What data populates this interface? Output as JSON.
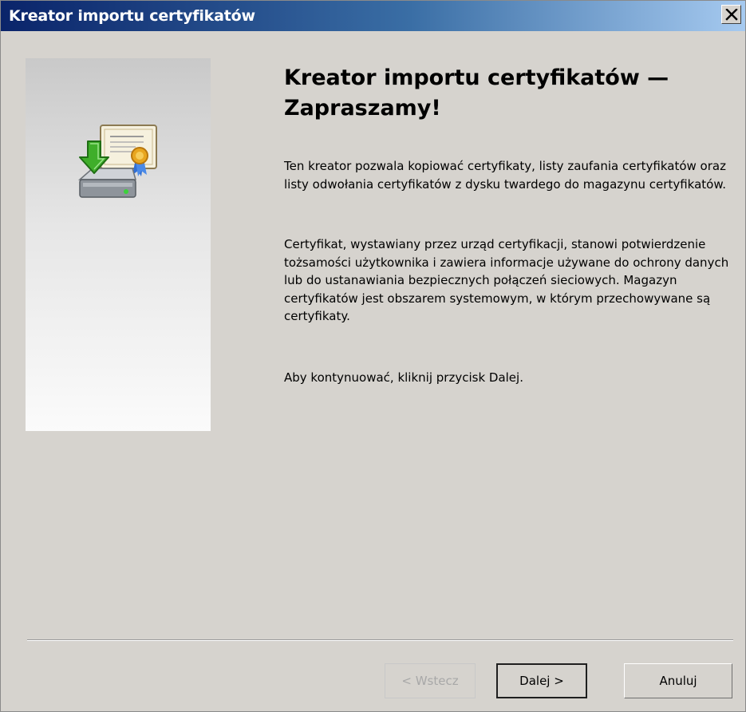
{
  "window": {
    "title": "Kreator importu certyfikatów"
  },
  "content": {
    "heading": "Kreator importu certyfikatów — Zapraszamy!",
    "paragraph1": "Ten kreator pozwala kopiować certyfikaty, listy zaufania certyfikatów oraz listy odwołania certyfikatów z dysku twardego do magazynu certyfikatów.",
    "paragraph2": "Certyfikat, wystawiany przez urząd certyfikacji, stanowi potwierdzenie tożsamości użytkownika i zawiera informacje używane do ochrony danych lub do ustanawiania bezpiecznych połączeń sieciowych. Magazyn certyfikatów jest obszarem systemowym, w którym przechowywane są certyfikaty.",
    "paragraph3": "Aby kontynuować, kliknij przycisk Dalej."
  },
  "buttons": {
    "back": "< Wstecz",
    "next": "Dalej >",
    "cancel": "Anuluj"
  },
  "icons": {
    "close": "close-icon",
    "wizard": "certificate-import-icon"
  },
  "colors": {
    "titlebar_start": "#0a246a",
    "titlebar_end": "#a6caf0",
    "window_bg": "#d6d3ce"
  }
}
